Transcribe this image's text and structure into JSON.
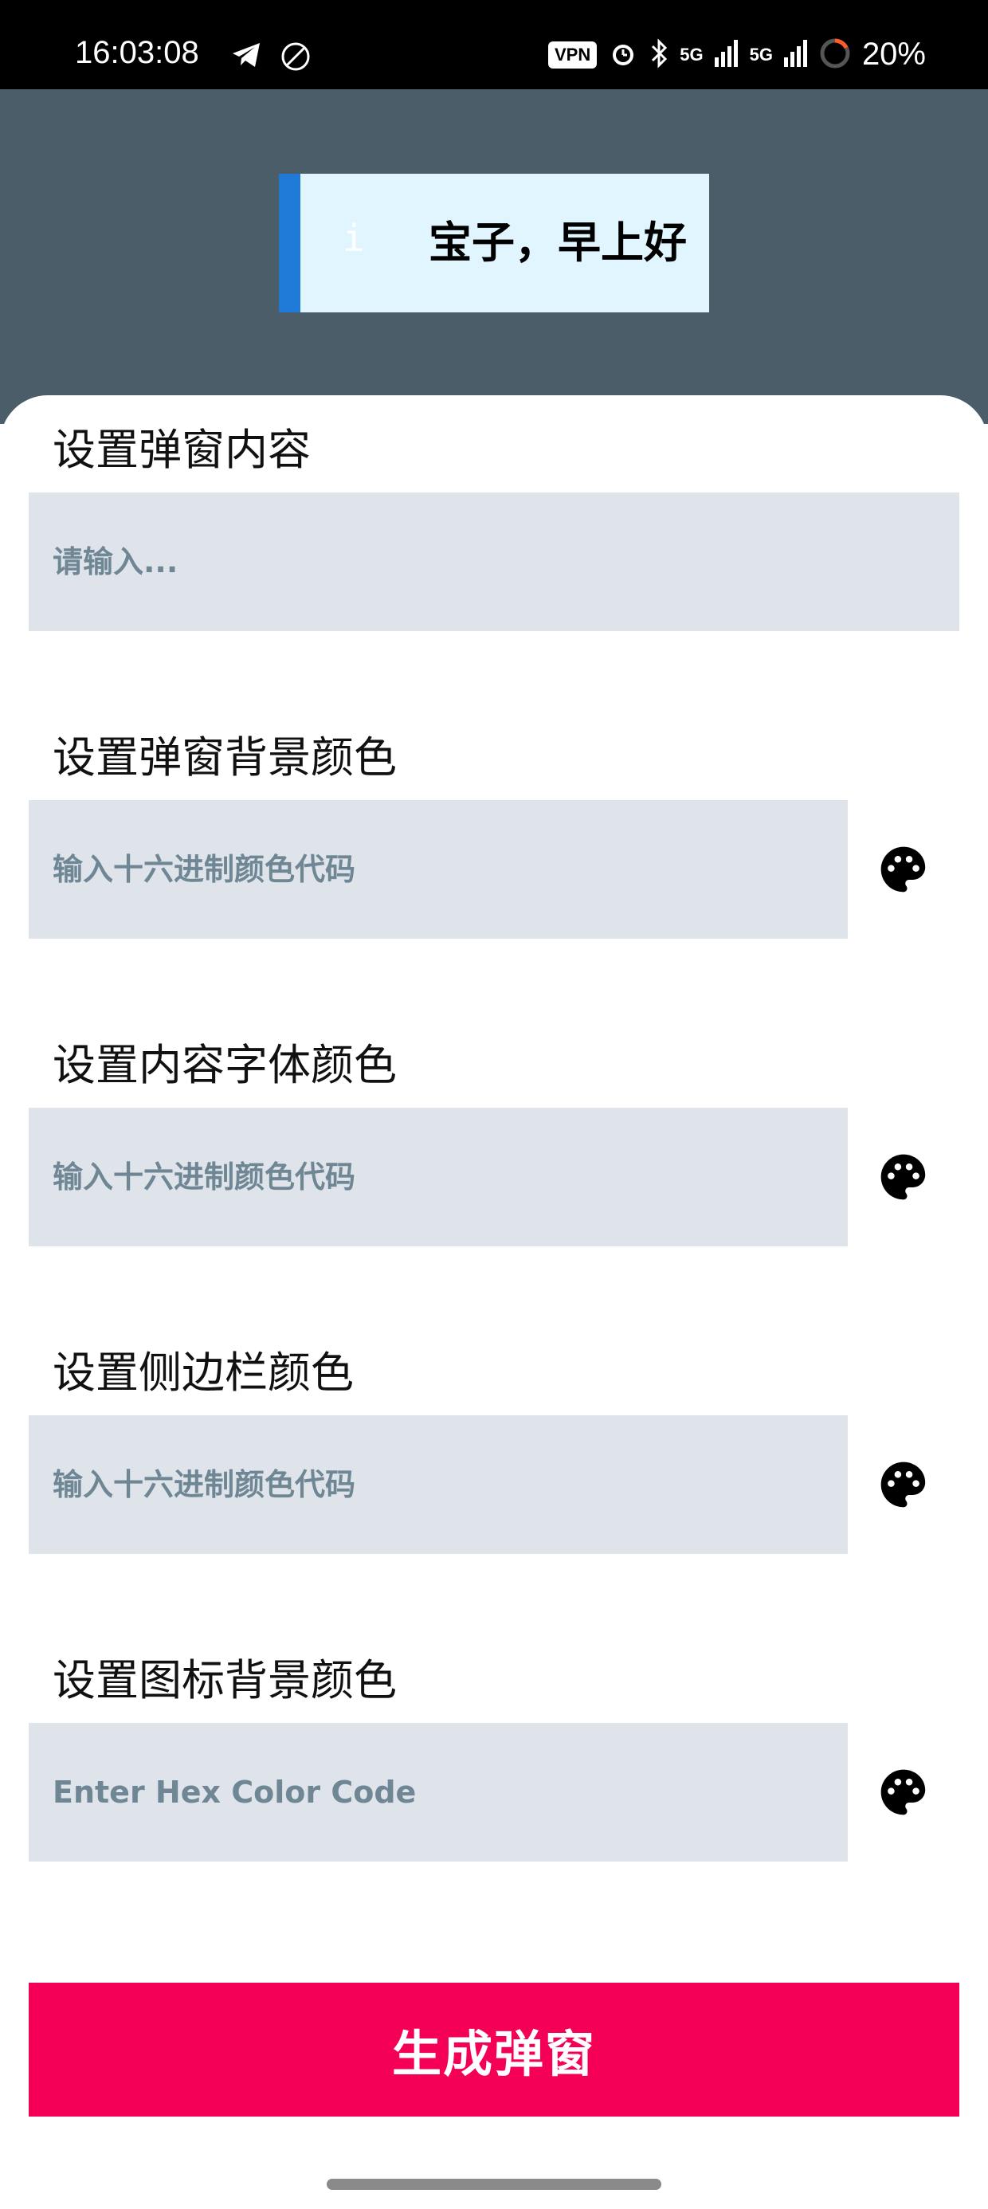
{
  "status_bar": {
    "time": "16:03:08",
    "left_icons": [
      "telegram-icon",
      "no-ads-icon"
    ],
    "vpn": "VPN",
    "signal_1": "5G",
    "signal_2": "5G",
    "battery": "20%"
  },
  "preview": {
    "icon": "i",
    "text": "宝子，早上好",
    "background_color": "#e1f5fe",
    "sidebar_color": "#1e7ad6"
  },
  "form": {
    "content": {
      "label": "设置弹窗内容",
      "placeholder": "请输入...",
      "value": ""
    },
    "bg_color": {
      "label": "设置弹窗背景颜色",
      "placeholder": "输入十六进制颜色代码",
      "value": ""
    },
    "font_color": {
      "label": "设置内容字体颜色",
      "placeholder": "输入十六进制颜色代码",
      "value": ""
    },
    "sidebar_color": {
      "label": "设置侧边栏颜色",
      "placeholder": "输入十六进制颜色代码",
      "value": ""
    },
    "icon_bg_color": {
      "label": "设置图标背景颜色",
      "placeholder": "Enter Hex Color Code",
      "value": ""
    }
  },
  "generate_button": "生成弹窗",
  "colors": {
    "header_bg": "#4b5d68",
    "input_bg": "#dfe3ea",
    "accent": "#f50057"
  }
}
